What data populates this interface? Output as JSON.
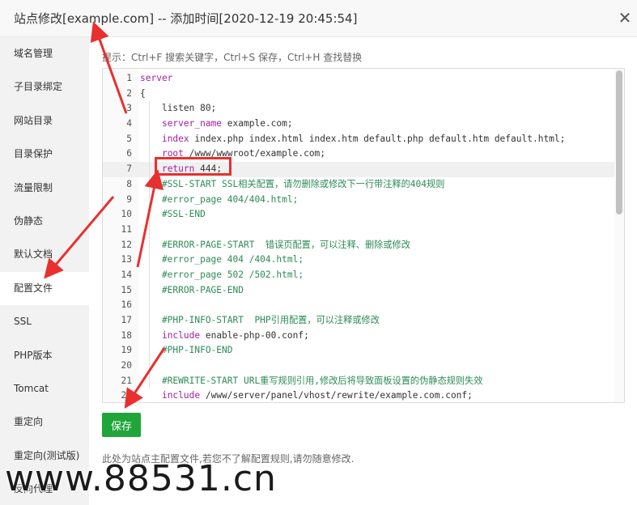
{
  "window": {
    "title": "站点修改[example.com] -- 添加时间[2020-12-19 20:45:54]",
    "close_glyph": "✕"
  },
  "sidebar": {
    "items": [
      {
        "label": "域名管理"
      },
      {
        "label": "子目录绑定"
      },
      {
        "label": "网站目录"
      },
      {
        "label": "目录保护"
      },
      {
        "label": "流量限制"
      },
      {
        "label": "伪静态"
      },
      {
        "label": "默认文档"
      },
      {
        "label": "配置文件",
        "active": true
      },
      {
        "label": "SSL"
      },
      {
        "label": "PHP版本"
      },
      {
        "label": "Tomcat"
      },
      {
        "label": "重定向"
      },
      {
        "label": "重定向(测试版)"
      },
      {
        "label": "反向代理"
      }
    ]
  },
  "hint": "提示：Ctrl+F 搜索关键字，Ctrl+S 保存，Ctrl+H 查找替换",
  "editor": {
    "active_line": 7,
    "lines": [
      {
        "n": "1",
        "segments": [
          {
            "t": "server",
            "c": "kw"
          }
        ]
      },
      {
        "n": "2",
        "segments": [
          {
            "t": "{",
            "c": ""
          }
        ]
      },
      {
        "n": "3",
        "segments": [
          {
            "t": "    listen 80;",
            "c": ""
          }
        ]
      },
      {
        "n": "4",
        "segments": [
          {
            "t": "    ",
            "c": ""
          },
          {
            "t": "server_name",
            "c": "kw"
          },
          {
            "t": " example.com;",
            "c": ""
          }
        ]
      },
      {
        "n": "5",
        "segments": [
          {
            "t": "    ",
            "c": ""
          },
          {
            "t": "index",
            "c": "kw"
          },
          {
            "t": " index.php index.html index.htm default.php default.htm default.html;",
            "c": ""
          }
        ]
      },
      {
        "n": "6",
        "segments": [
          {
            "t": "    ",
            "c": ""
          },
          {
            "t": "root",
            "c": "kw"
          },
          {
            "t": " /www/wwwroot/example.com;",
            "c": ""
          }
        ]
      },
      {
        "n": "7",
        "segments": [
          {
            "t": "    ",
            "c": ""
          },
          {
            "t": "return",
            "c": "kw"
          },
          {
            "t": " 444;",
            "c": ""
          }
        ]
      },
      {
        "n": "8",
        "segments": [
          {
            "t": "    #SSL-START SSL相关配置，请勿删除或修改下一行带注释的404规则",
            "c": "cm"
          }
        ]
      },
      {
        "n": "9",
        "segments": [
          {
            "t": "    #error_page 404/404.html;",
            "c": "cm"
          }
        ]
      },
      {
        "n": "10",
        "segments": [
          {
            "t": "    #SSL-END",
            "c": "cm"
          }
        ]
      },
      {
        "n": "11",
        "segments": [
          {
            "t": "",
            "c": ""
          }
        ]
      },
      {
        "n": "12",
        "segments": [
          {
            "t": "    #ERROR-PAGE-START  错误页配置，可以注释、删除或修改",
            "c": "cm"
          }
        ]
      },
      {
        "n": "13",
        "segments": [
          {
            "t": "    #error_page 404 /404.html;",
            "c": "cm"
          }
        ]
      },
      {
        "n": "14",
        "segments": [
          {
            "t": "    #error_page 502 /502.html;",
            "c": "cm"
          }
        ]
      },
      {
        "n": "15",
        "segments": [
          {
            "t": "    #ERROR-PAGE-END",
            "c": "cm"
          }
        ]
      },
      {
        "n": "16",
        "segments": [
          {
            "t": "",
            "c": ""
          }
        ]
      },
      {
        "n": "17",
        "segments": [
          {
            "t": "    #PHP-INFO-START  PHP引用配置，可以注释或修改",
            "c": "cm"
          }
        ]
      },
      {
        "n": "18",
        "segments": [
          {
            "t": "    ",
            "c": ""
          },
          {
            "t": "include",
            "c": "kw"
          },
          {
            "t": " enable-php-00.conf;",
            "c": ""
          }
        ]
      },
      {
        "n": "19",
        "segments": [
          {
            "t": "    #PHP-INFO-END",
            "c": "cm"
          }
        ]
      },
      {
        "n": "20",
        "segments": [
          {
            "t": "",
            "c": ""
          }
        ]
      },
      {
        "n": "21",
        "segments": [
          {
            "t": "    #REWRITE-START URL重写规则引用,修改后将导致面板设置的伪静态规则失效",
            "c": "cm"
          }
        ]
      },
      {
        "n": "22",
        "segments": [
          {
            "t": "    ",
            "c": ""
          },
          {
            "t": "include",
            "c": "kw"
          },
          {
            "t": " /www/server/panel/vhost/rewrite/example.com.conf;",
            "c": ""
          }
        ]
      }
    ]
  },
  "save_button": "保存",
  "note": "此处为站点主配置文件,若您不了解配置规则,请勿随意修改.",
  "watermark": "www.88531.cn",
  "colors": {
    "keyword": "#a01fa0",
    "comment": "#2e8b57",
    "save_button": "#20a53a",
    "annotation": "#e8302f"
  }
}
